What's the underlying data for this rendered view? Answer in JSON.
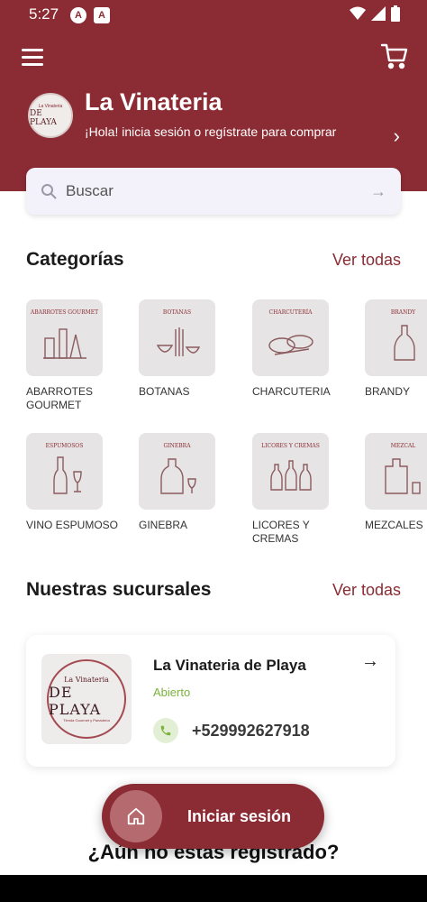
{
  "status_bar": {
    "time": "5:27",
    "badges": [
      "A",
      "A"
    ],
    "icons": [
      "wifi-icon",
      "signal-icon",
      "battery-icon"
    ]
  },
  "header": {
    "store_name": "La Vinateria",
    "login_prompt": "¡Hola! inicia sesión o regístrate para comprar",
    "logo_text_top": "La Vinateria",
    "logo_text_main": "DE PLAYA",
    "background_color": "#8b2b33"
  },
  "search": {
    "placeholder": "Buscar"
  },
  "categories": {
    "title": "Categorías",
    "see_all": "Ver todas",
    "items": [
      {
        "label": "ABARROTES GOURMET",
        "thumb": "ABARROTES GOURMET",
        "icon": "groceries-icon"
      },
      {
        "label": "BOTANAS",
        "thumb": "BOTANAS",
        "icon": "snacks-icon"
      },
      {
        "label": "CHARCUTERIA",
        "thumb": "CHARCUTERÍA",
        "icon": "charcuterie-icon"
      },
      {
        "label": "BRANDY",
        "thumb": "BRANDY",
        "icon": "brandy-bottle-icon"
      },
      {
        "label": "VINO ESPUMOSO",
        "thumb": "ESPUMOSOS",
        "icon": "sparkling-wine-icon"
      },
      {
        "label": "GINEBRA",
        "thumb": "GINEBRA",
        "icon": "gin-bottle-icon"
      },
      {
        "label": "LICORES Y CREMAS",
        "thumb": "LICORES Y CREMAS",
        "icon": "liqueur-bottles-icon"
      },
      {
        "label": "MEZCALES",
        "thumb": "MEZCAL",
        "icon": "mezcal-bottle-icon"
      }
    ]
  },
  "branches": {
    "title": "Nuestras sucursales",
    "see_all": "Ver todas",
    "items": [
      {
        "name": "La Vinateria de Playa",
        "status": "Abierto",
        "phone": "+529992627918",
        "logo_top": "La Vinateria",
        "logo_main": "DE PLAYA",
        "logo_bottom": "Tienda Gourmet y Panadería"
      }
    ]
  },
  "login_cta": {
    "label": "Iniciar sesión",
    "signup_question": "¿Aún no estas registrado?"
  },
  "colors": {
    "brand": "#8b2b33",
    "open_status": "#7ab23c"
  }
}
